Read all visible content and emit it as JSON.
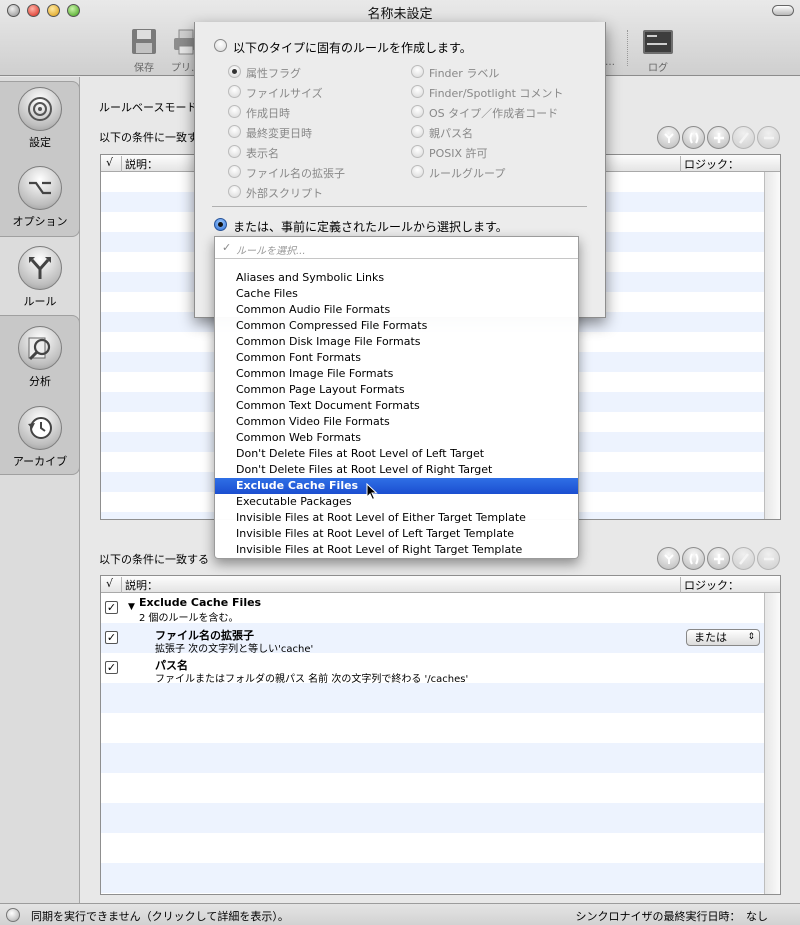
{
  "window": {
    "title": "名称未設定"
  },
  "toolbar": {
    "items": [
      {
        "label": "保存",
        "icon": "floppy-disk-icon"
      },
      {
        "label": "プリ…",
        "icon": "printer-icon"
      },
      {
        "label": "…",
        "icon": "toolbar-overflow-icon"
      },
      {
        "label": "ログ",
        "icon": "log-console-icon"
      }
    ]
  },
  "sidebar": {
    "items": [
      {
        "label": "設定",
        "icon": "target-icon"
      },
      {
        "label": "オプション",
        "icon": "option-key-icon"
      },
      {
        "label": "ルール",
        "icon": "branch-arrows-icon"
      },
      {
        "label": "分析",
        "icon": "magnifier-document-icon"
      },
      {
        "label": "アーカイブ",
        "icon": "clock-history-icon"
      }
    ]
  },
  "main": {
    "mode_label": "ルールベースモード",
    "upper_condition_label": "以下の条件に一致す",
    "lower_condition_label": "以下の条件に一致する",
    "columns": {
      "check": "√",
      "description": "説明：",
      "logic": "ロジック："
    },
    "lower_rules": [
      {
        "title": "Exclude Cache Files",
        "subtitle": "2 個のルールを含む。",
        "checked": true
      },
      {
        "title": "ファイル名の拡張子",
        "subtitle": "拡張子 次の文字列と等しい'cache'",
        "checked": true,
        "logic": "または"
      },
      {
        "title": "パス名",
        "subtitle": "ファイルまたはフォルダの親パス 名前 次の文字列で終わる '/caches'",
        "checked": true
      }
    ]
  },
  "sheet": {
    "option1_label": "以下のタイプに固有のルールを作成します。",
    "left_types": [
      "属性フラグ",
      "ファイルサイズ",
      "作成日時",
      "最終変更日時",
      "表示名",
      "ファイル名の拡張子",
      "外部スクリプト"
    ],
    "right_types": [
      "Finder ラベル",
      "Finder/Spotlight コメント",
      "OS タイプ／作成者コード",
      "親パス名",
      "POSIX 許可",
      "ルールグループ"
    ],
    "option2_label": "または、事前に定義されたルールから選択します。"
  },
  "dropdown": {
    "placeholder": "ルールを選択...",
    "check": "✓",
    "selected_index": 13,
    "items": [
      "Aliases and Symbolic Links",
      "Cache Files",
      "Common Audio File Formats",
      "Common Compressed File Formats",
      "Common Disk Image File Formats",
      "Common Font Formats",
      "Common Image File Formats",
      "Common Page Layout Formats",
      "Common Text Document Formats",
      "Common Video File Formats",
      "Common Web Formats",
      "Don't Delete Files at Root Level of Left Target",
      "Don't Delete Files at Root Level of Right Target",
      "Exclude Cache Files",
      "Executable Packages",
      "Invisible Files at Root Level of Either Target Template",
      "Invisible Files at Root Level of Left Target Template",
      "Invisible Files at Root Level of Right Target Template"
    ]
  },
  "status": {
    "left": "同期を実行できません（クリックして詳細を表示）。",
    "right": "シンクロナイザの最終実行日時：　なし"
  },
  "colors": {
    "highlight": "#2f6fe6",
    "stripe": "#edf3fe",
    "accent_radio": "#2f6fd6"
  }
}
